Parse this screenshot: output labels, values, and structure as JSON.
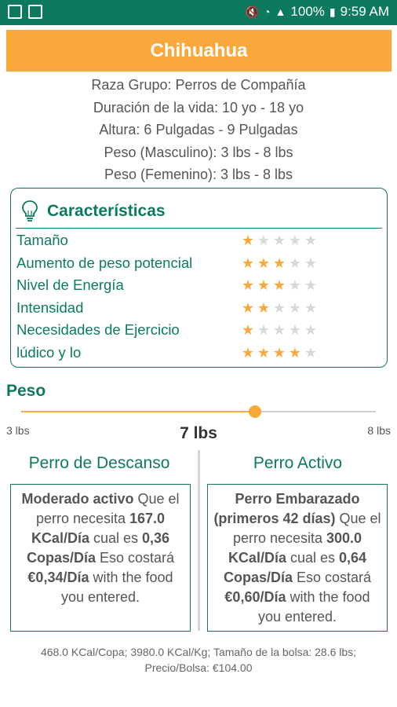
{
  "status_bar": {
    "battery": "100%",
    "time": "9:59 AM",
    "icons": [
      "image-icon",
      "screenshot-icon",
      "mute-icon",
      "wifi-icon",
      "signal-icon",
      "battery-icon"
    ]
  },
  "title": "Chihuahua",
  "info": [
    "Raza Grupo: Perros de Compañía",
    "Duración de la vida: 10 yo - 18 yo",
    "Altura: 6 Pulgadas - 9 Pulgadas",
    "Peso (Masculino): 3 lbs - 8 lbs",
    "Peso (Femenino): 3 lbs - 8 lbs"
  ],
  "characteristics": {
    "title": "Características",
    "icon": "lightbulb-icon",
    "items": [
      {
        "label": "Tamaño",
        "rating": 1
      },
      {
        "label": "Aumento de peso potencial",
        "rating": 3
      },
      {
        "label": "Nivel de Energía",
        "rating": 3
      },
      {
        "label": "Intensidad",
        "rating": 2
      },
      {
        "label": "Necesidades de Ejercicio",
        "rating": 1
      },
      {
        "label": "lúdico y lo",
        "rating": 4
      }
    ],
    "max_rating": 5
  },
  "weight": {
    "title": "Peso",
    "min_label": "3 lbs",
    "max_label": "8 lbs",
    "current_label": "7 lbs",
    "min": 3,
    "max": 8,
    "value": 7
  },
  "columns": {
    "left_title": "Perro de Descanso",
    "right_title": "Perro Activo",
    "left": {
      "activity": "Moderado activo",
      "t1": " Que el perro necesita ",
      "kcal": "167.0 KCal/Día",
      "t2": " cual es ",
      "cups": "0,36 Copas/Día",
      "t3": " Eso costará ",
      "cost": "€0,34/Día",
      "t4": " with the food you entered."
    },
    "right": {
      "activity": "Perro Embarazado (primeros 42 días)",
      "t1": " Que el perro necesita ",
      "kcal": "300.0 KCal/Día",
      "t2": " cual es ",
      "cups": "0,64 Copas/Día",
      "t3": " Eso costará ",
      "cost": "€0,60/Día",
      "t4": " with the food you entered."
    }
  },
  "footer": "468.0 KCal/Copa; 3980.0 KCal/Kg; Tamaño de la bolsa: 28.6 lbs; Precio/Bolsa: €104.00",
  "colors": {
    "primary": "#0d7a5f",
    "accent": "#f9a93b",
    "star_off": "#d7d7d7"
  }
}
